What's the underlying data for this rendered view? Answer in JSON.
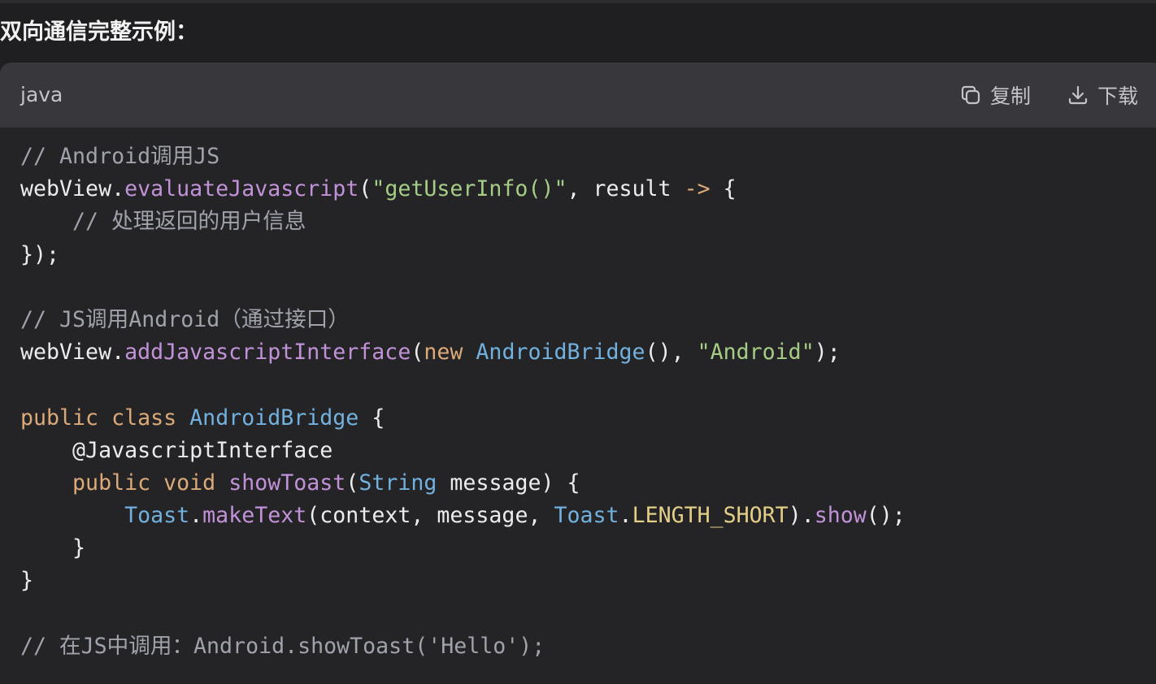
{
  "section_title": "双向通信完整示例：",
  "code_block": {
    "language": "java",
    "copy_label": "复制",
    "download_label": "下载",
    "lines": [
      [
        {
          "t": "// Android调用JS",
          "c": "comment"
        }
      ],
      [
        {
          "t": "webView.",
          "c": "plain"
        },
        {
          "t": "evaluateJavascript",
          "c": "func"
        },
        {
          "t": "(",
          "c": "plain"
        },
        {
          "t": "\"getUserInfo()\"",
          "c": "string"
        },
        {
          "t": ", result ",
          "c": "plain"
        },
        {
          "t": "->",
          "c": "keyword"
        },
        {
          "t": " {",
          "c": "plain"
        }
      ],
      [
        {
          "t": "    // 处理返回的用户信息",
          "c": "comment"
        }
      ],
      [
        {
          "t": "});",
          "c": "plain"
        }
      ],
      [],
      [
        {
          "t": "// JS调用Android（通过接口）",
          "c": "comment"
        }
      ],
      [
        {
          "t": "webView.",
          "c": "plain"
        },
        {
          "t": "addJavascriptInterface",
          "c": "func"
        },
        {
          "t": "(",
          "c": "plain"
        },
        {
          "t": "new",
          "c": "keyword"
        },
        {
          "t": " ",
          "c": "plain"
        },
        {
          "t": "AndroidBridge",
          "c": "type"
        },
        {
          "t": "(), ",
          "c": "plain"
        },
        {
          "t": "\"Android\"",
          "c": "string"
        },
        {
          "t": ");",
          "c": "plain"
        }
      ],
      [],
      [
        {
          "t": "public",
          "c": "keyword"
        },
        {
          "t": " ",
          "c": "plain"
        },
        {
          "t": "class",
          "c": "keyword"
        },
        {
          "t": " ",
          "c": "plain"
        },
        {
          "t": "AndroidBridge",
          "c": "type"
        },
        {
          "t": " {",
          "c": "plain"
        }
      ],
      [
        {
          "t": "    @JavascriptInterface",
          "c": "plain"
        }
      ],
      [
        {
          "t": "    ",
          "c": "plain"
        },
        {
          "t": "public",
          "c": "keyword"
        },
        {
          "t": " ",
          "c": "plain"
        },
        {
          "t": "void",
          "c": "keyword"
        },
        {
          "t": " ",
          "c": "plain"
        },
        {
          "t": "showToast",
          "c": "func"
        },
        {
          "t": "(",
          "c": "plain"
        },
        {
          "t": "String",
          "c": "type"
        },
        {
          "t": " message) {",
          "c": "plain"
        }
      ],
      [
        {
          "t": "        ",
          "c": "plain"
        },
        {
          "t": "Toast",
          "c": "type"
        },
        {
          "t": ".",
          "c": "plain"
        },
        {
          "t": "makeText",
          "c": "func"
        },
        {
          "t": "(context, message, ",
          "c": "plain"
        },
        {
          "t": "Toast",
          "c": "type"
        },
        {
          "t": ".",
          "c": "plain"
        },
        {
          "t": "LENGTH_SHORT",
          "c": "const"
        },
        {
          "t": ").",
          "c": "plain"
        },
        {
          "t": "show",
          "c": "func"
        },
        {
          "t": "();",
          "c": "plain"
        }
      ],
      [
        {
          "t": "    }",
          "c": "plain"
        }
      ],
      [
        {
          "t": "}",
          "c": "plain"
        }
      ],
      [],
      [
        {
          "t": "// 在JS中调用：Android.showToast('Hello');",
          "c": "comment"
        }
      ]
    ]
  },
  "colors": {
    "background": "#1f1f21",
    "code_background": "#242427",
    "header_background": "#38383c",
    "comment": "#a0a3ac",
    "keyword": "#dca978",
    "function": "#c292d8",
    "string": "#a5cd86",
    "type": "#72b1de",
    "constant": "#e3cf87"
  },
  "icons": {
    "copy": "copy-icon",
    "download": "download-icon"
  }
}
